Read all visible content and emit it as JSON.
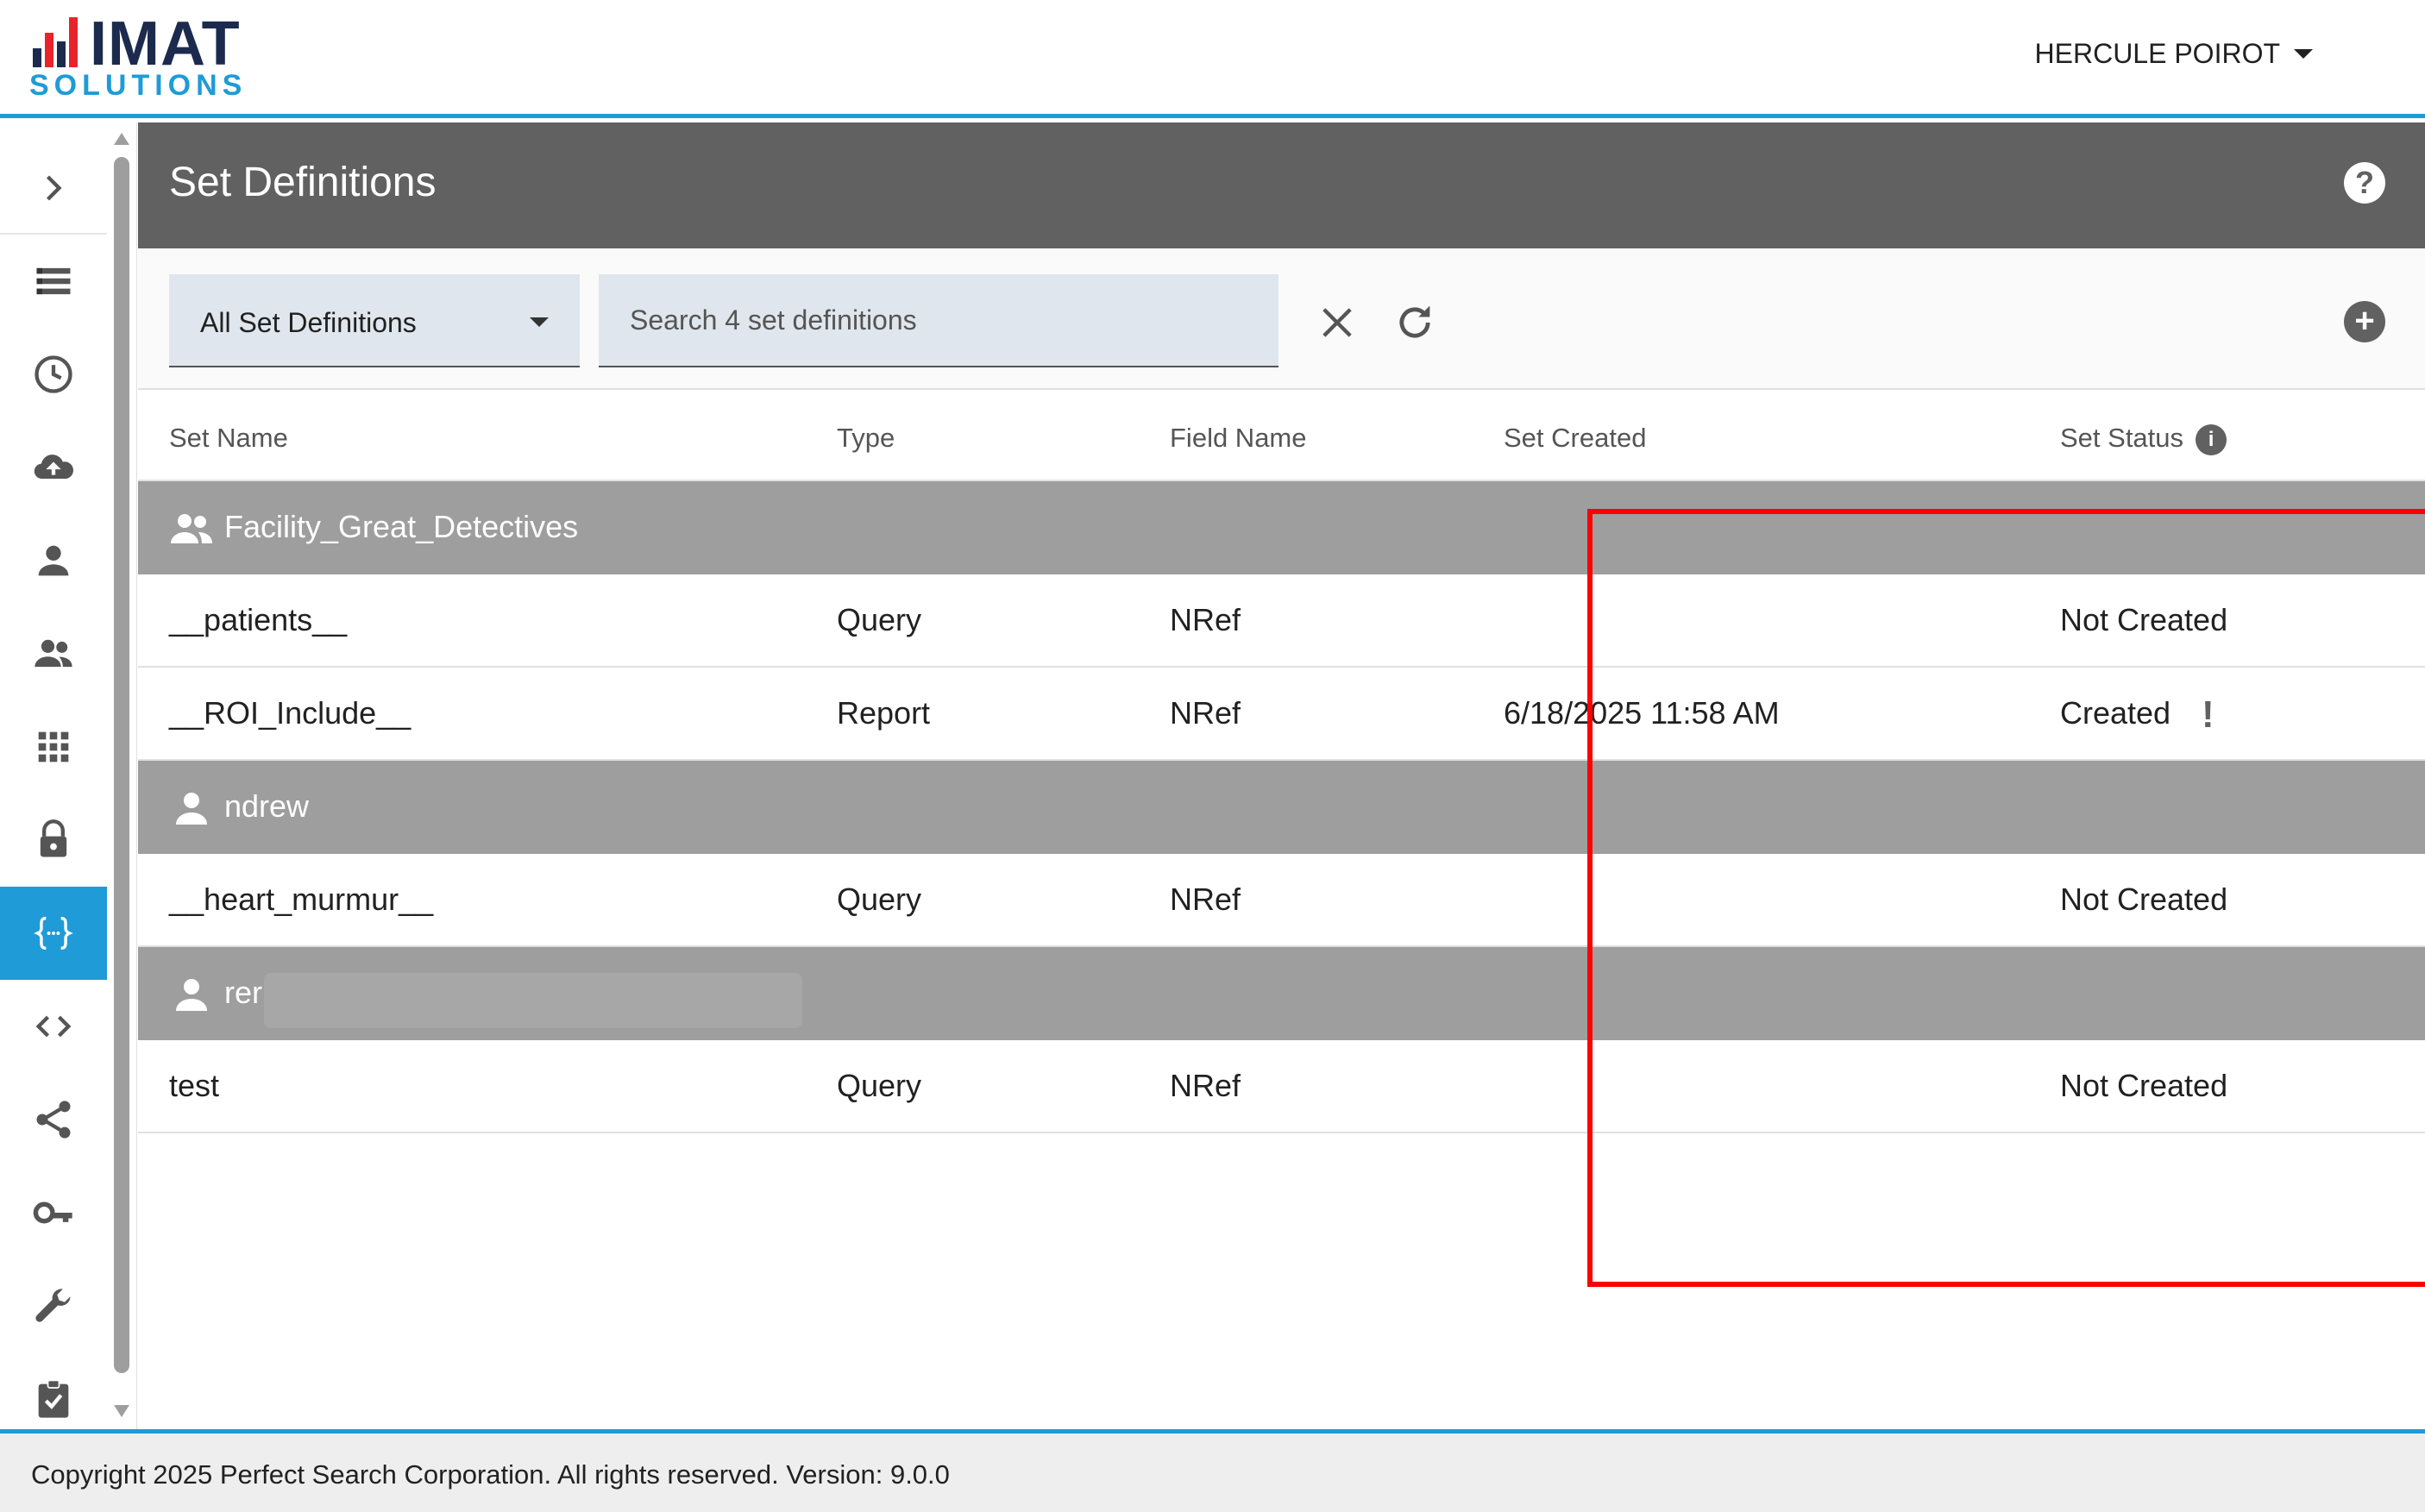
{
  "header": {
    "logo_word": "IMAT",
    "logo_sub": "SOLUTIONS",
    "user_name": "HERCULE POIROT"
  },
  "sidebar": {
    "items": [
      {
        "icon": "chevron-right-icon"
      },
      {
        "icon": "list-icon"
      },
      {
        "icon": "clock-icon"
      },
      {
        "icon": "cloud-upload-icon"
      },
      {
        "icon": "person-icon"
      },
      {
        "icon": "group-icon"
      },
      {
        "icon": "apps-grid-icon"
      },
      {
        "icon": "lock-icon"
      },
      {
        "icon": "braces-icon",
        "active": true
      },
      {
        "icon": "code-icon"
      },
      {
        "icon": "share-icon"
      },
      {
        "icon": "key-icon"
      },
      {
        "icon": "wrench-icon"
      },
      {
        "icon": "clipboard-check-icon"
      }
    ]
  },
  "page": {
    "title": "Set Definitions",
    "help_glyph": "?"
  },
  "toolbar": {
    "filter_value": "All Set Definitions",
    "search_placeholder": "Search 4 set definitions",
    "add_glyph": "+"
  },
  "table": {
    "headers": {
      "set_name": "Set Name",
      "type": "Type",
      "field_name": "Field Name",
      "set_created": "Set Created",
      "set_status": "Set Status",
      "info_glyph": "i"
    },
    "groups": [
      {
        "name": "Facility_Great_Detectives",
        "icon": "group-icon",
        "rows": [
          {
            "set_name": "__patients__",
            "type": "Query",
            "field_name": "NRef",
            "set_created": "",
            "set_status": "Not Created"
          },
          {
            "set_name": "__ROI_Include__",
            "type": "Report",
            "field_name": "NRef",
            "set_created": "6/18/2025 11:58 AM",
            "set_status": "Created",
            "warning": "!"
          }
        ]
      },
      {
        "name": "ndrew",
        "icon": "person-icon",
        "rows": [
          {
            "set_name": "__heart_murmur__",
            "type": "Query",
            "field_name": "NRef",
            "set_created": "",
            "set_status": "Not Created"
          }
        ]
      },
      {
        "name": "rer",
        "icon": "person-icon",
        "rows": [
          {
            "set_name": "test",
            "type": "Query",
            "field_name": "NRef",
            "set_created": "",
            "set_status": "Not Created"
          }
        ]
      }
    ]
  },
  "footer": {
    "text": "Copyright 2025 Perfect Search Corporation. All rights reserved. Version: 9.0.0"
  },
  "colors": {
    "accent": "#1f9bd7",
    "title_bar": "#616161",
    "group_row": "#9e9e9e",
    "highlight": "#ff0000"
  }
}
